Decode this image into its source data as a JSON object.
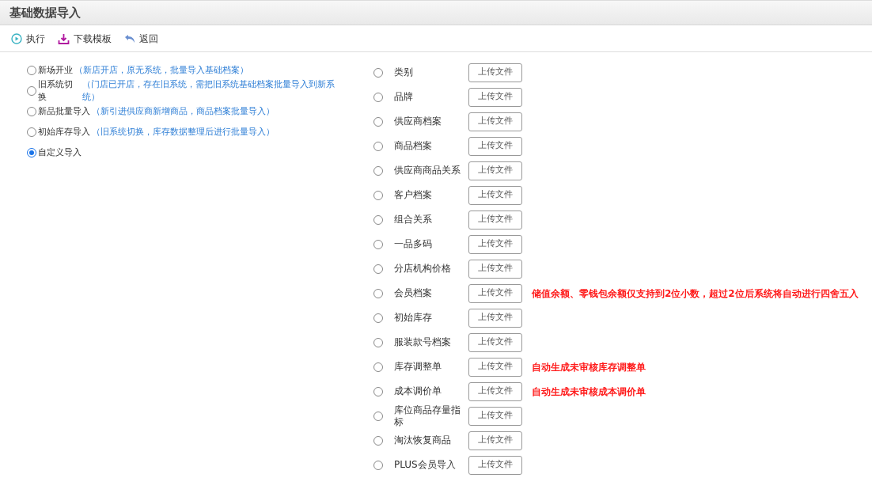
{
  "title": "基础数据导入",
  "toolbar": [
    {
      "kind": "run",
      "label": "执行"
    },
    {
      "kind": "download",
      "label": "下载模板"
    },
    {
      "kind": "back",
      "label": "返回"
    }
  ],
  "modes": [
    {
      "label": "新场开业",
      "hint": "（新店开店，原无系统，批量导入基础档案）",
      "selected": false
    },
    {
      "label": "旧系统切换",
      "hint": "（门店已开店，存在旧系统，需把旧系统基础档案批量导入到新系统）",
      "selected": false
    },
    {
      "label": "新品批量导入",
      "hint": "（新引进供应商新增商品，商品档案批量导入）",
      "selected": false
    },
    {
      "label": "初始库存导入",
      "hint": "（旧系统切换，库存数据整理后进行批量导入）",
      "selected": false
    },
    {
      "label": "自定义导入",
      "selected": true
    }
  ],
  "imports": [
    {
      "label": "类别",
      "button": "上传文件",
      "selected": false
    },
    {
      "label": "品牌",
      "button": "上传文件",
      "selected": false
    },
    {
      "label": "供应商档案",
      "button": "上传文件",
      "selected": false
    },
    {
      "label": "商品档案",
      "button": "上传文件",
      "selected": false
    },
    {
      "label": "供应商商品关系",
      "button": "上传文件",
      "selected": false
    },
    {
      "label": "客户档案",
      "button": "上传文件",
      "selected": false
    },
    {
      "label": "组合关系",
      "button": "上传文件",
      "selected": false
    },
    {
      "label": "一品多码",
      "button": "上传文件",
      "selected": false
    },
    {
      "label": "分店机构价格",
      "button": "上传文件",
      "selected": false
    },
    {
      "label": "会员档案",
      "button": "上传文件",
      "selected": false,
      "note": "储值余额、零钱包余额仅支持到2位小数，超过2位后系统将自动进行四舍五入"
    },
    {
      "label": "初始库存",
      "button": "上传文件",
      "selected": false
    },
    {
      "label": "服装款号档案",
      "button": "上传文件",
      "selected": false
    },
    {
      "label": "库存调整单",
      "button": "上传文件",
      "selected": false,
      "note": "自动生成未审核库存调整单"
    },
    {
      "label": "成本调价单",
      "button": "上传文件",
      "selected": false,
      "note": "自动生成未审核成本调价单"
    },
    {
      "label": "库位商品存量指标",
      "button": "上传文件",
      "selected": false
    },
    {
      "label": "淘汰恢复商品",
      "button": "上传文件",
      "selected": false
    },
    {
      "label": "PLUS会员导入",
      "button": "上传文件",
      "selected": false
    }
  ]
}
